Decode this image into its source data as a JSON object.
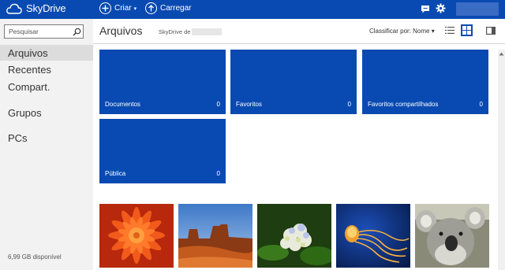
{
  "header": {
    "app_name": "SkyDrive",
    "create_label": "Criar",
    "upload_label": "Carregar",
    "icons": [
      "skydrive-logo-icon",
      "plus-icon",
      "upload-icon",
      "chat-icon",
      "gear-icon"
    ],
    "brand_color": "#094ab2"
  },
  "sidebar": {
    "search_placeholder": "Pesquisar",
    "items": [
      {
        "label": "Arquivos",
        "active": true
      },
      {
        "label": "Recentes"
      },
      {
        "label": "Compart."
      },
      {
        "label": "Grupos"
      },
      {
        "label": "PCs"
      }
    ],
    "storage_text": "6,99 GB disponível"
  },
  "main": {
    "title": "Arquivos",
    "breadcrumb": "SkyDrive de",
    "sort_label": "Classificar por: Nome",
    "folders": [
      {
        "name": "Documentos",
        "count": "0"
      },
      {
        "name": "Favoritos",
        "count": "0"
      },
      {
        "name": "Favoritos compartilhados",
        "count": "0"
      },
      {
        "name": "Pública",
        "count": "0"
      }
    ],
    "photos": [
      "chrysanthemum-photo",
      "desert-photo",
      "hydrangeas-photo",
      "jellyfish-photo",
      "koala-photo"
    ]
  }
}
